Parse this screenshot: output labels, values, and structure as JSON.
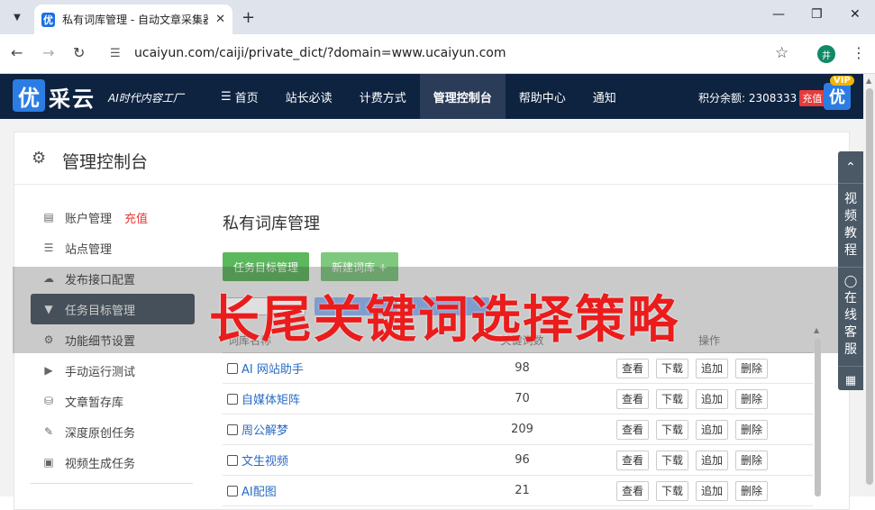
{
  "browser": {
    "tab_title": "私有词库管理 - 自动文章采集器",
    "url": "ucaiyun.com/caiji/private_dict/?domain=www.ucaiyun.com",
    "profile_initial": "井",
    "favicon_char": "优"
  },
  "header": {
    "logo_char": "优",
    "logo_text": "采云",
    "slogan": "AI时代内容工厂",
    "nav": [
      "首页",
      "站长必读",
      "计费方式",
      "管理控制台",
      "帮助中心",
      "通知"
    ],
    "nav_active_index": 3,
    "points_label": "积分余额: 2308333",
    "recharge": "充值",
    "vip": "VIP",
    "vip_logo": "优"
  },
  "panel": {
    "title": "管理控制台"
  },
  "sidebar": {
    "items": [
      {
        "label": "账户管理",
        "icon": "bar-chart-icon",
        "extra": "充值"
      },
      {
        "label": "站点管理",
        "icon": "server-icon"
      },
      {
        "label": "发布接口配置",
        "icon": "cloud-upload-icon"
      },
      {
        "label": "任务目标管理",
        "icon": "filter-icon",
        "active": true
      },
      {
        "label": "功能细节设置",
        "icon": "cogs-icon"
      },
      {
        "label": "手动运行测试",
        "icon": "play-circle-icon"
      },
      {
        "label": "文章暂存库",
        "icon": "database-icon"
      },
      {
        "label": "深度原创任务",
        "icon": "edit-icon"
      },
      {
        "label": "视频生成任务",
        "icon": "video-camera-icon"
      }
    ]
  },
  "main": {
    "title": "私有词库管理",
    "btn_task": "任务目标管理",
    "btn_new": "新建词库 +",
    "columns": [
      "词库名称",
      "关键词数",
      "操作"
    ],
    "rows": [
      {
        "name": "AI 网站助手",
        "count": "98"
      },
      {
        "name": "自媒体矩阵",
        "count": "70"
      },
      {
        "name": "周公解梦",
        "count": "209"
      },
      {
        "name": "文生视频",
        "count": "96"
      },
      {
        "name": "AI配图",
        "count": "21"
      }
    ],
    "actions": [
      "查看",
      "下载",
      "追加",
      "删除"
    ]
  },
  "overlay": {
    "caption": "长尾关键词选择策略"
  },
  "float_panel": {
    "video_tutorial": "视频教程",
    "online_support": "在线客服"
  },
  "colors": {
    "header_bg": "#0d2340",
    "active_sidebar": "#4b5866",
    "green": "#5cb85c",
    "caption_red": "#ea1c1c",
    "link_blue": "#2a6cc4"
  }
}
